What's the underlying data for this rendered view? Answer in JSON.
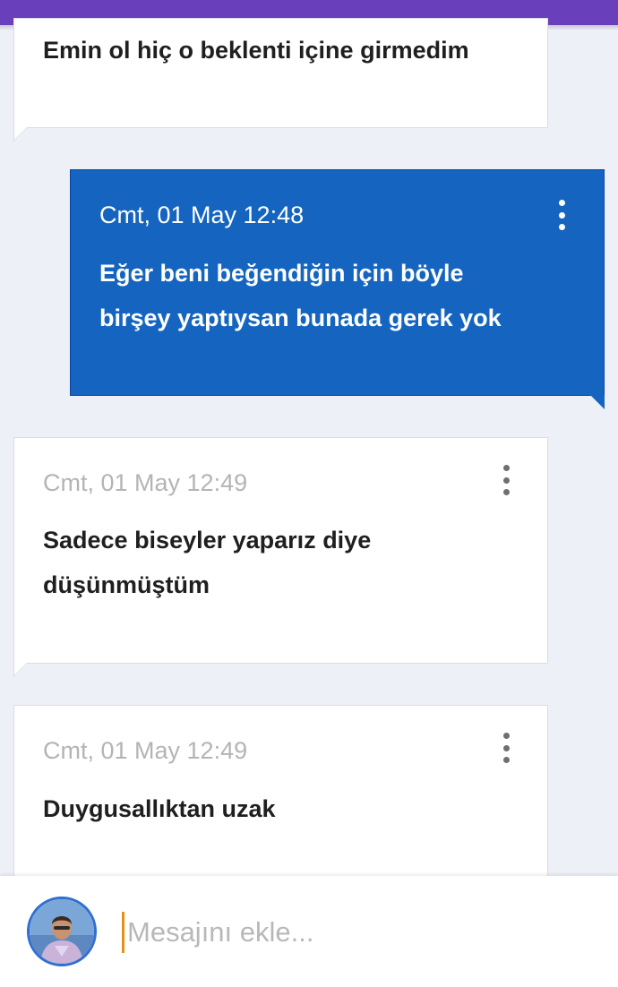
{
  "status_bar": {
    "color": "#6a3fbc"
  },
  "colors": {
    "outgoing_bubble": "#1565c0",
    "incoming_bubble": "#ffffff",
    "background": "#eef0f7",
    "cursor": "#e69219"
  },
  "messages": [
    {
      "direction": "incoming",
      "timestamp": "",
      "lines": [
        "Emin ol hiç o beklenti içine girmedim"
      ]
    },
    {
      "direction": "outgoing",
      "timestamp": "Cmt, 01 May 12:48",
      "lines": [
        "Eğer beni beğendiğin için böyle",
        "birşey yaptıysan bunada gerek yok"
      ],
      "menu_icon": "more-vert-icon"
    },
    {
      "direction": "incoming",
      "timestamp": "Cmt, 01 May 12:49",
      "lines": [
        "Sadece biseyler yaparız diye",
        "düşünmüştüm"
      ],
      "menu_icon": "more-vert-icon"
    },
    {
      "direction": "incoming",
      "timestamp": "Cmt, 01 May 12:49",
      "lines": [
        "Duygusallıktan uzak"
      ],
      "menu_icon": "more-vert-icon"
    }
  ],
  "composer": {
    "placeholder": "Mesajını ekle...",
    "value": "",
    "avatar_icon": "user-avatar-icon"
  }
}
